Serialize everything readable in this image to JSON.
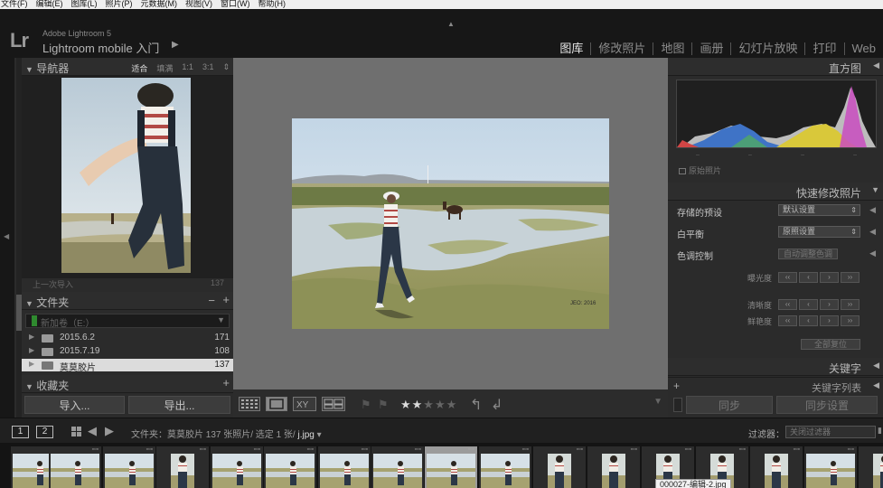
{
  "menu": [
    "文件(F)",
    "编辑(E)",
    "图库(L)",
    "照片(P)",
    "元数据(M)",
    "视图(V)",
    "窗口(W)",
    "帮助(H)"
  ],
  "brand": {
    "logo": "Lr",
    "small": "Adobe Lightroom 5",
    "big": "Lightroom mobile 入门",
    "arrow": "▶"
  },
  "modules": [
    "图库",
    "修改照片",
    "地图",
    "画册",
    "幻灯片放映",
    "打印",
    "Web"
  ],
  "left": {
    "navigator": {
      "title": "导航器",
      "zoom": [
        "适合",
        "填满",
        "1:1",
        "3:1"
      ]
    },
    "truncated_row": {
      "label": "上一次导入",
      "count": "137"
    },
    "folders": {
      "title": "文件夹",
      "volume": "新加卷（E:）",
      "items": [
        {
          "name": "2015.6.2",
          "count": "171"
        },
        {
          "name": "2015.7.19",
          "count": "108"
        },
        {
          "name": "莫莫胶片",
          "count": "137"
        }
      ]
    },
    "collections": {
      "title": "收藏夹"
    },
    "import_label": "导入...",
    "export_label": "导出..."
  },
  "toolbar": {
    "stars": "★★★★★",
    "rating": 2
  },
  "right": {
    "histogram": {
      "title": "直方图",
      "original_label": "原始照片"
    },
    "quick_develop": {
      "title": "快速修改照片",
      "saved_preset_label": "存储的预设",
      "saved_preset_value": "默认设置",
      "wb_label": "白平衡",
      "wb_value": "原照设置",
      "tone_label": "色调控制",
      "auto_tone": "自动调整色调",
      "exposure_label": "曝光度",
      "clarity_label": "清晰度",
      "vibrance_label": "鲜艳度",
      "reset_label": "全部复位"
    },
    "keywording": {
      "title": "关键字"
    },
    "keyword_list": {
      "title": "关键字列表"
    },
    "sync_label": "同步",
    "sync_settings_label": "同步设置"
  },
  "filmbar": {
    "num1": "1",
    "num2": "2",
    "path_prefix": "文件夹：莫莫胶片",
    "path_count": "137 张照片/ 选定 1 张/",
    "path_file": "j.jpg",
    "path_caret": "▾",
    "filter_label": "过滤器：",
    "filter_value": "关闭过滤器"
  },
  "tooltip": "000027-编辑-2.jpg",
  "colors": {
    "accent_module": "#e6e6e6",
    "selected_folder": "#dcdcdc",
    "volume_green": "#2f8a2f"
  }
}
